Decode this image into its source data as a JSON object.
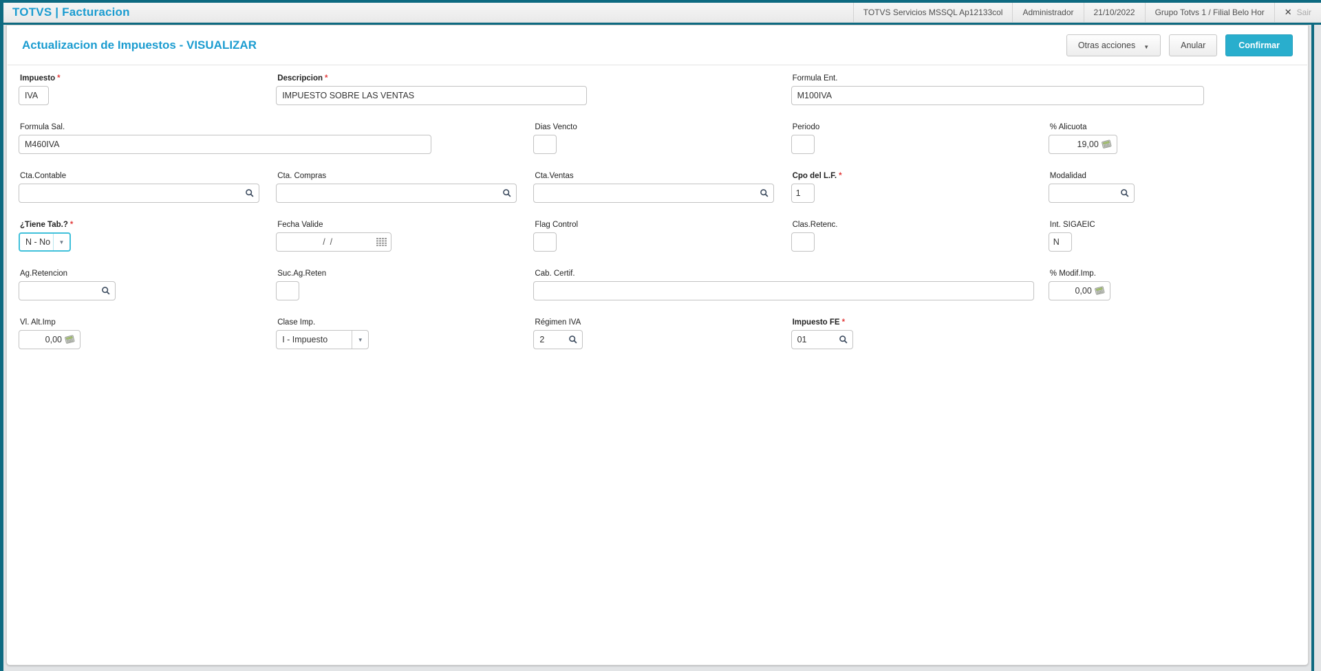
{
  "topbar": {
    "app_title": "TOTVS | Facturacion",
    "environment": "TOTVS Servicios MSSQL Ap12133col",
    "user": "Administrador",
    "date": "21/10/2022",
    "branch": "Grupo Totvs 1 / Filial Belo Hor",
    "exit_label": "Sair"
  },
  "header": {
    "title": "Actualizacion de Impuestos - VISUALIZAR",
    "buttons": {
      "other_actions": "Otras acciones",
      "cancel": "Anular",
      "confirm": "Confirmar"
    }
  },
  "icons": {
    "dropdown_caret": "▼",
    "close": "✕"
  },
  "colors": {
    "frame_teal": "#0e6a81",
    "title_blue": "#1b9cd0",
    "confirm_button": "#29aecd",
    "required_asterisk": "#e23b3b"
  },
  "form": {
    "fields": [
      {
        "label": "Impuesto",
        "value": "IVA",
        "required": true
      },
      {
        "label": "Descripcion",
        "value": "IMPUESTO SOBRE LAS VENTAS",
        "required": true
      },
      {
        "label": "Formula Ent.",
        "value": "M100IVA"
      },
      {
        "label": "Formula Sal.",
        "value": "M460IVA"
      },
      {
        "label": "Dias Vencto",
        "value": ""
      },
      {
        "label": "Periodo",
        "value": ""
      },
      {
        "label": "% Alicuota",
        "value": "19,00"
      },
      {
        "label": "Cta.Contable",
        "value": ""
      },
      {
        "label": "Cta. Compras",
        "value": ""
      },
      {
        "label": "Cta.Ventas",
        "value": ""
      },
      {
        "label": "Cpo del L.F.",
        "value": "1",
        "required": true
      },
      {
        "label": "Modalidad",
        "value": ""
      },
      {
        "label": "¿Tiene Tab.?",
        "value": "N - No",
        "required": true
      },
      {
        "label": "Fecha Valide",
        "value": "/  /"
      },
      {
        "label": "Flag Control",
        "value": ""
      },
      {
        "label": "Clas.Retenc.",
        "value": ""
      },
      {
        "label": "Int. SIGAEIC",
        "value": "N"
      },
      {
        "label": "Ag.Retencion",
        "value": ""
      },
      {
        "label": "Suc.Ag.Reten",
        "value": ""
      },
      {
        "label": "Cab. Certif.",
        "value": ""
      },
      {
        "label": "% Modif.Imp.",
        "value": "0,00"
      },
      {
        "label": "Vl. Alt.Imp",
        "value": "0,00"
      },
      {
        "label": "Clase Imp.",
        "value": "I - Impuesto"
      },
      {
        "label": "Régimen IVA",
        "value": "2"
      },
      {
        "label": "Impuesto FE",
        "value": "01",
        "required": true
      }
    ]
  }
}
